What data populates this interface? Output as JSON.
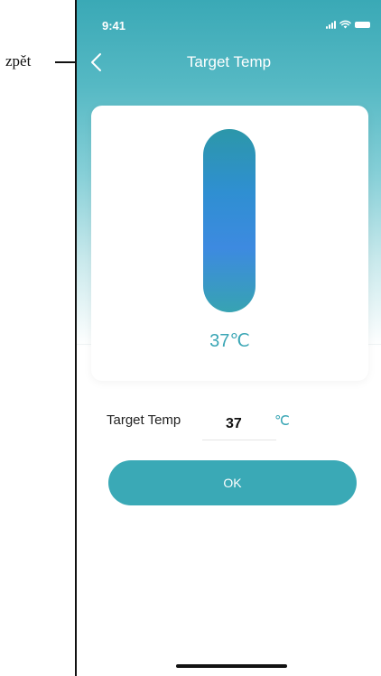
{
  "annotation": {
    "label": "zpět"
  },
  "status_bar": {
    "time": "9:41"
  },
  "nav": {
    "title": "Target Temp"
  },
  "thermometer": {
    "reading": "37℃"
  },
  "form": {
    "label": "Target Temp",
    "value": "37",
    "unit": "℃"
  },
  "actions": {
    "ok_label": "OK"
  },
  "colors": {
    "accent": "#3aa9b6",
    "text_accent": "#3aa6b5"
  },
  "icons": {
    "back": "chevron-left-icon",
    "signal": "signal-icon",
    "wifi": "wifi-icon",
    "battery": "battery-icon"
  }
}
